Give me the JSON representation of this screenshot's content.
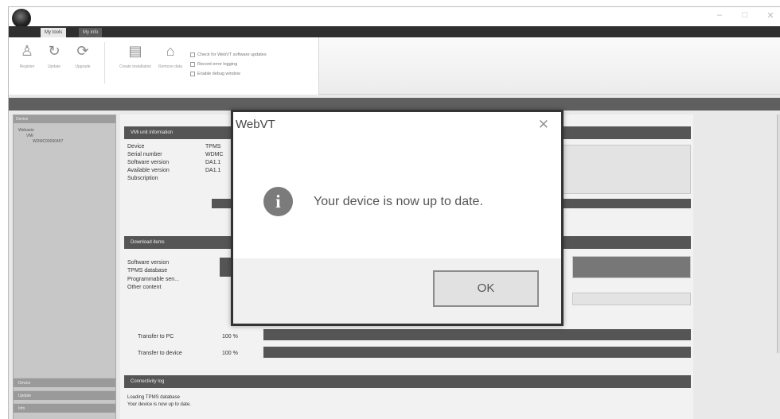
{
  "window": {
    "controls": [
      "–",
      "□",
      "✕"
    ]
  },
  "ribbon": {
    "tabs": [
      "My tools",
      "My info"
    ],
    "buttons": [
      "Register",
      "Update",
      "Upgrade",
      "Create installation",
      "Remove data"
    ],
    "checks": [
      "Check for WebVT software updates",
      "Record error logging",
      "Enable debug window"
    ]
  },
  "left_pane": {
    "header": "Device",
    "tree": [
      "Webasto",
      "VMi",
      "WDMC00000457"
    ],
    "bottom_tabs": [
      "Device",
      "Update",
      "Info"
    ]
  },
  "main": {
    "vmi_section": {
      "title": "VMi unit information",
      "rows": [
        {
          "label": "Device",
          "value": "TPMS"
        },
        {
          "label": "Serial number",
          "value": "WDMC"
        },
        {
          "label": "Software version",
          "value": "DA1.1"
        },
        {
          "label": "Available version",
          "value": "DA1.1"
        },
        {
          "label": "Subscription",
          "value": ""
        }
      ]
    },
    "download_section": {
      "title": "Download items",
      "rows": [
        "Software version",
        "TPMS database",
        "Programmable sen...",
        "Other content"
      ]
    },
    "transfer": [
      {
        "label": "Transfer to PC",
        "percent_text": "100 %",
        "progress": 100
      },
      {
        "label": "Transfer to device",
        "percent_text": "100 %",
        "progress": 100
      }
    ],
    "log": {
      "title": "Connectivity log",
      "lines": [
        "Loading TPMS database",
        "Your device is now up to date."
      ]
    }
  },
  "dialog": {
    "title": "WebVT",
    "close": "✕",
    "icon": "i",
    "message": "Your device is now up to date.",
    "ok_label": "OK"
  }
}
